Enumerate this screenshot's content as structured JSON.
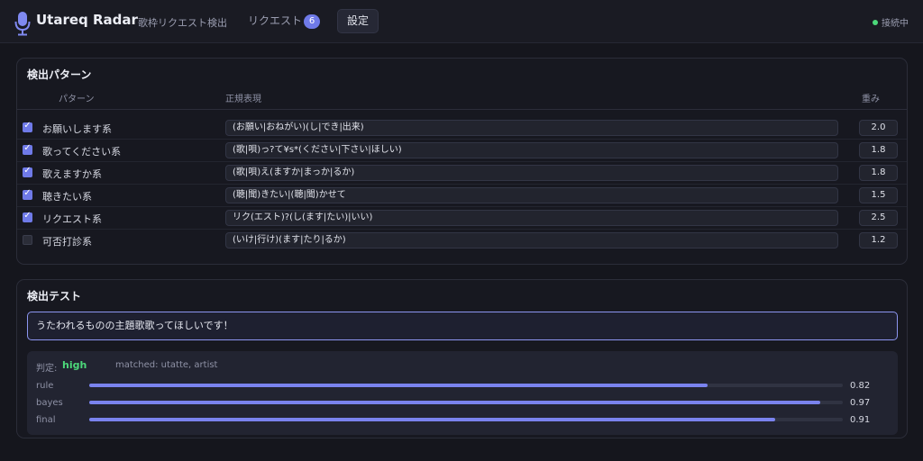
{
  "header": {
    "app_title": "Utareq Radar",
    "app_subtitle": "歌枠リクエスト検出",
    "nav_requests_label": "リクエスト",
    "nav_requests_count": "6",
    "nav_settings_label": "設定",
    "status_text": "接続中",
    "status_color": "#4cd87a",
    "accent_color": "#6f7ae8"
  },
  "patterns": {
    "title": "検出パターン",
    "col_pattern": "パターン",
    "col_regex": "正規表現",
    "col_weight": "重み",
    "rows": [
      {
        "enabled": true,
        "name": "お願いします系",
        "regex": "(お願い|おねがい)(し|でき|出来)",
        "weight": "2.0"
      },
      {
        "enabled": true,
        "name": "歌ってください系",
        "regex": "(歌|唄)っ?て¥s*(ください|下さい|ほしい)",
        "weight": "1.8"
      },
      {
        "enabled": true,
        "name": "歌えますか系",
        "regex": "(歌|唄)え(ますか|まっか|るか)",
        "weight": "1.8"
      },
      {
        "enabled": true,
        "name": "聴きたい系",
        "regex": "(聴|聞)きたい|(聴|聞)かせて",
        "weight": "1.5"
      },
      {
        "enabled": true,
        "name": "リクエスト系",
        "regex": "リク(エスト)?(し(ます|たい)|いい)",
        "weight": "2.5"
      },
      {
        "enabled": false,
        "name": "可否打診系",
        "regex": "(いけ|行け)(ます|たり|るか)",
        "weight": "1.2"
      }
    ]
  },
  "test": {
    "title": "検出テスト",
    "input_value": "うたわれるものの主題歌歌ってほしいです！",
    "verdict_label": "判定:",
    "verdict_value": "high",
    "matched": "matched: utatte, artist",
    "scores": [
      {
        "label": "rule",
        "value": 0.82,
        "display": "0.82"
      },
      {
        "label": "bayes",
        "value": 0.97,
        "display": "0.97"
      },
      {
        "label": "final",
        "value": 0.91,
        "display": "0.91"
      }
    ]
  }
}
